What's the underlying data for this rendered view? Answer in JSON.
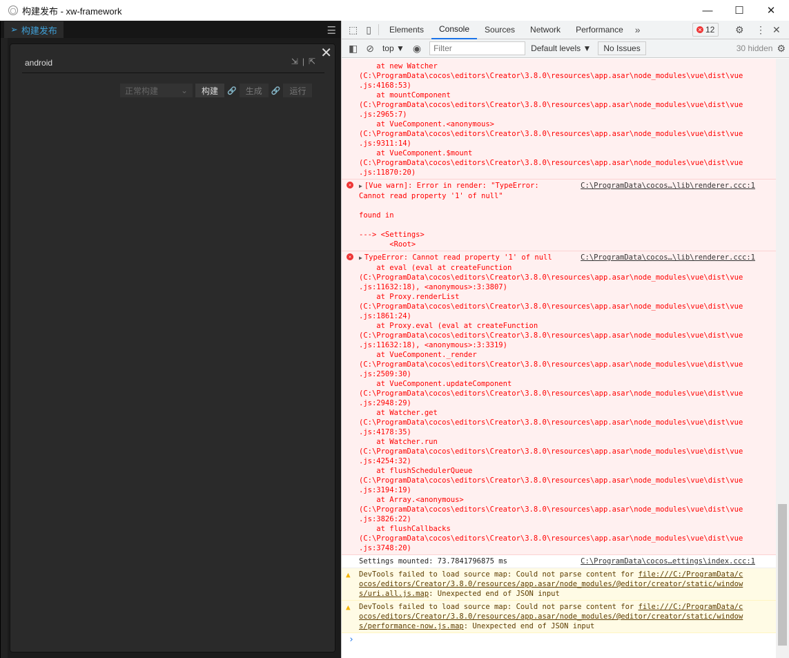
{
  "window": {
    "title": "构建发布 - xw-framework",
    "minimize": "—",
    "maximize": "☐",
    "close": "✕"
  },
  "left": {
    "tab_label": "构建发布",
    "menu_icon": "☰",
    "panel": {
      "title": "android",
      "close": "✕",
      "import_icon": "⇲",
      "separator": "|",
      "export_icon": "⇱",
      "build_mode": "正常构建",
      "chevron": "⌄",
      "build": "构建",
      "link": "🔗",
      "generate": "生成",
      "run": "运行"
    }
  },
  "devtools": {
    "tabs": [
      "Elements",
      "Console",
      "Sources",
      "Network",
      "Performance"
    ],
    "more": "»",
    "error_count": "12",
    "error_x": "✕",
    "context": "top ▼",
    "filter_placeholder": "Filter",
    "levels": "Default levels ▼",
    "issues": "No Issues",
    "hidden": "30 hidden",
    "path_line": "(C:\\ProgramData\\cocos\\editors\\Creator\\3.8.0\\resources\\app.asar\\node_modules\\vue\\dist\\vue",
    "entry1_frames": [
      {
        "at": "new Watcher",
        "loc": ".js:4168:53)"
      },
      {
        "at": "mountComponent",
        "loc": ".js:2965:7)"
      },
      {
        "at": "VueComponent.<anonymous>",
        "loc": ".js:9311:14)"
      },
      {
        "at": "VueComponent.$mount",
        "loc": ".js:11870:20)"
      }
    ],
    "entry2": {
      "text": "[Vue warn]: Error in render: \"TypeError:\nCannot read property '1' of null\"\n\nfound in\n\n---> <Settings>\n       <Root>",
      "source": "C:\\ProgramData\\cocos…\\lib\\renderer.ccc:1"
    },
    "entry3": {
      "text": "TypeError: Cannot read property '1' of null",
      "source": "C:\\ProgramData\\cocos…\\lib\\renderer.ccc:1",
      "frames": [
        {
          "at": "eval (eval at createFunction",
          "loc": ".js:11632:18), <anonymous>:3:3807)"
        },
        {
          "at": "Proxy.renderList",
          "loc": ".js:1861:24)"
        },
        {
          "at": "Proxy.eval (eval at createFunction",
          "loc": ".js:11632:18), <anonymous>:3:3319)"
        },
        {
          "at": "VueComponent._render",
          "loc": ".js:2509:30)"
        },
        {
          "at": "VueComponent.updateComponent",
          "loc": ".js:2948:29)"
        },
        {
          "at": "Watcher.get",
          "loc": ".js:4178:35)"
        },
        {
          "at": "Watcher.run",
          "loc": ".js:4254:32)"
        },
        {
          "at": "flushSchedulerQueue",
          "loc": ".js:3194:19)"
        },
        {
          "at": "Array.<anonymous>",
          "loc": ".js:3826:22)"
        },
        {
          "at": "flushCallbacks",
          "loc": ".js:3748:20)"
        }
      ]
    },
    "entry4": {
      "text": "Settings mounted: 73.7841796875 ms",
      "source": "C:\\ProgramData\\cocos…ettings\\index.ccc:1"
    },
    "warn1": {
      "pre": "DevTools failed to load source map: Could not parse content for ",
      "link": "file:///C:/ProgramData/c\nocos/editors/Creator/3.8.0/resources/app.asar/node_modules/@editor/creator/static/window\ns/uri.all.js.map",
      "post": ": Unexpected end of JSON input"
    },
    "warn2": {
      "pre": "DevTools failed to load source map: Could not parse content for ",
      "link": "file:///C:/ProgramData/c\nocos/editors/Creator/3.8.0/resources/app.asar/node_modules/@editor/creator/static/window\ns/performance-now.js.map",
      "post": ": Unexpected end of JSON input"
    },
    "prompt": "›"
  }
}
